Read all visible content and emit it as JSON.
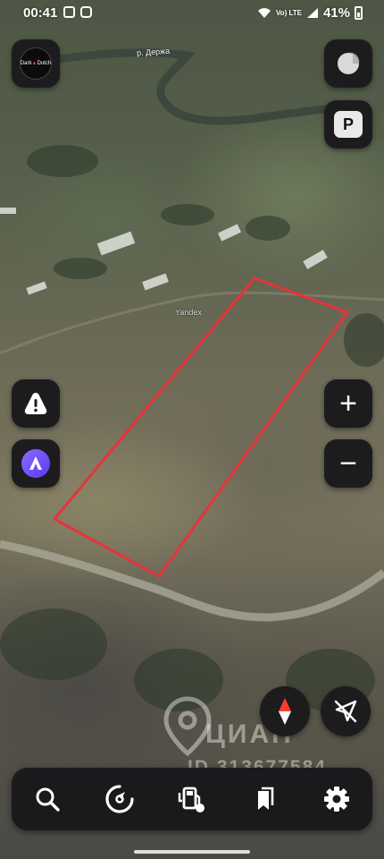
{
  "status_bar": {
    "time": "00:41",
    "network": "Vo) LTE",
    "battery": "41%"
  },
  "map": {
    "river_label": "р. Держа",
    "provider_label": "Yandex",
    "highlight_color": "#e8323a"
  },
  "watermark": {
    "brand": "ЦИАН",
    "id_text": "ID 313677584"
  },
  "logo": {
    "text_a": "Dark",
    "text_b": "Dutch"
  },
  "buttons": {
    "layers_icon": "layers-icon",
    "parking_label": "P",
    "warning_icon": "warning-triangle-icon",
    "alice_icon": "voice-assistant-icon",
    "zoom_in_label": "+",
    "zoom_out_label": "−",
    "compass_icon": "compass-icon",
    "no_location_icon": "location-off-icon"
  },
  "bottom_bar": {
    "items": [
      {
        "icon": "search-icon"
      },
      {
        "icon": "navigator-icon"
      },
      {
        "icon": "gas-station-icon"
      },
      {
        "icon": "bookmarks-icon"
      },
      {
        "icon": "settings-gear-icon"
      }
    ]
  }
}
